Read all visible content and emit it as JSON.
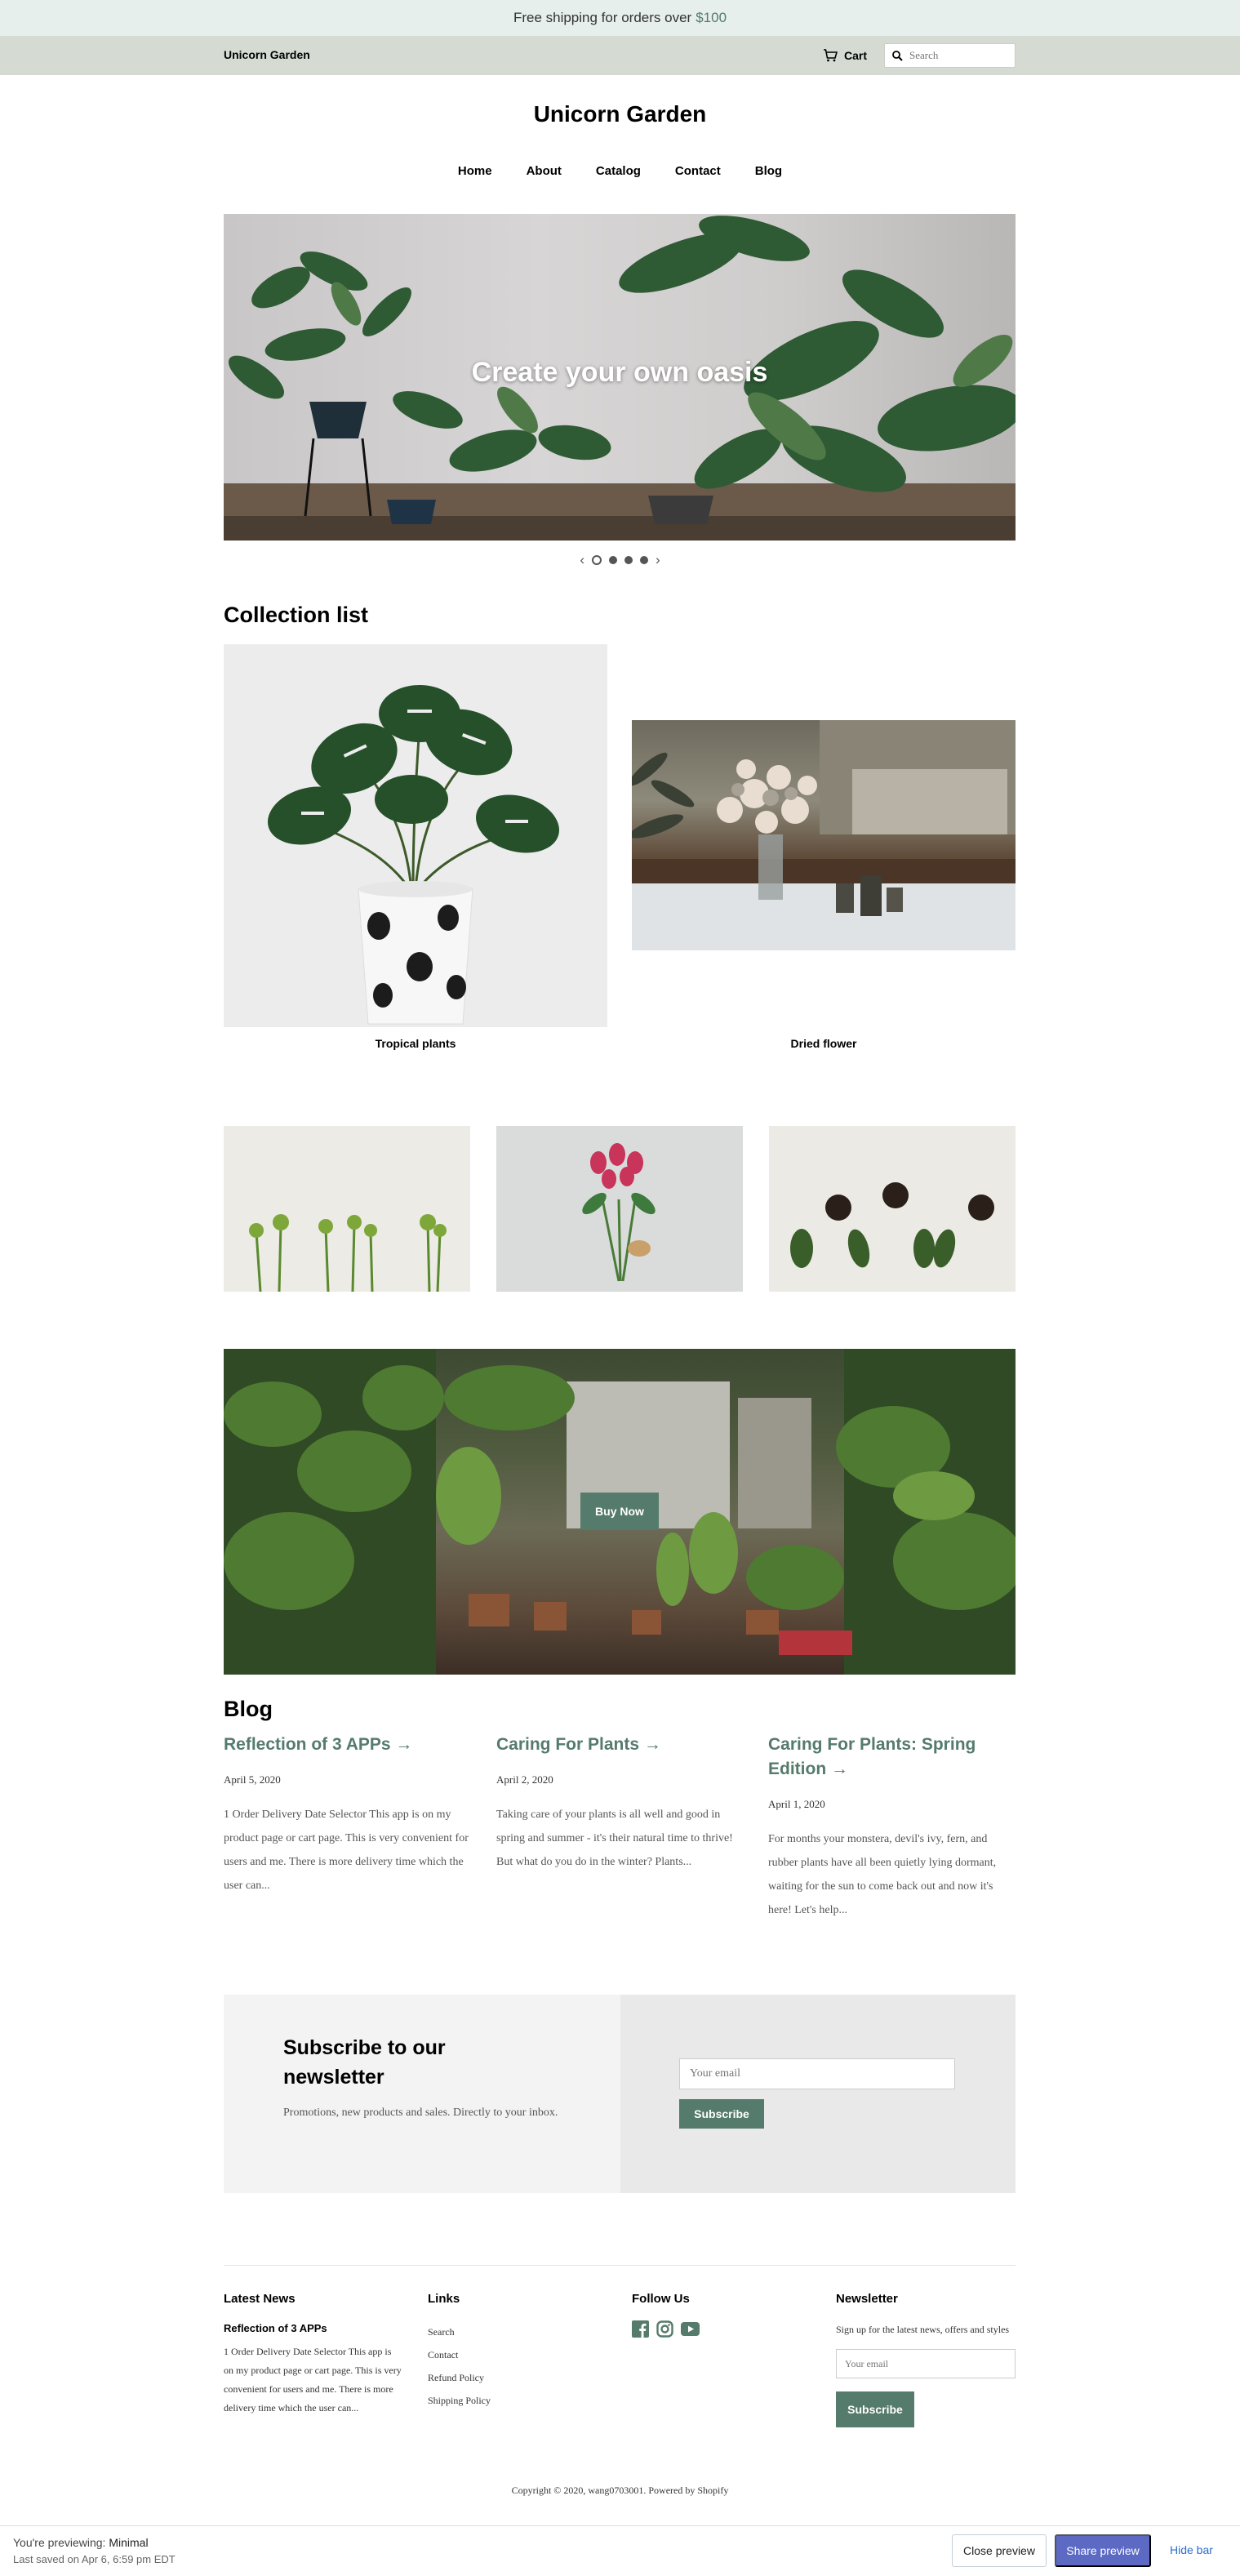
{
  "announcement": {
    "text": "Free shipping for orders over",
    "amount": "$100"
  },
  "header": {
    "brand": "Unicorn Garden",
    "cart_label": "Cart",
    "search_placeholder": "Search"
  },
  "site_title": "Unicorn Garden",
  "nav": [
    "Home",
    "About",
    "Catalog",
    "Contact",
    "Blog"
  ],
  "hero": {
    "title": "Create your own oasis",
    "slides": 4,
    "active_slide": 1
  },
  "collections": {
    "heading": "Collection list",
    "items": [
      {
        "label": "Tropical plants"
      },
      {
        "label": "Dried flower"
      }
    ]
  },
  "banner": {
    "button_label": "Buy Now"
  },
  "blog": {
    "heading": "Blog",
    "posts": [
      {
        "title": "Reflection of 3 APPs →",
        "date": "April 5, 2020",
        "excerpt": "1 Order Delivery Date Selector  This app is on my product page or cart page. This is very convenient for users and me. There is more delivery time which the user can..."
      },
      {
        "title": "Caring For Plants →",
        "date": "April 2, 2020",
        "excerpt": "Taking care of your plants is all well and good in spring and summer - it's their natural time to thrive! But what do you do in the winter? Plants..."
      },
      {
        "title": "Caring For Plants: Spring Edition →",
        "date": "April 1, 2020",
        "excerpt": "For months your monstera, devil's ivy, fern, and rubber plants have all been quietly lying dormant, waiting for the sun to come back out and now it's here! Let's help..."
      }
    ]
  },
  "newsletter_section": {
    "heading": "Subscribe to our newsletter",
    "text": "Promotions, new products and sales. Directly to your inbox.",
    "email_placeholder": "Your email",
    "button_label": "Subscribe"
  },
  "footer": {
    "latest_news": {
      "heading": "Latest News",
      "post_title": "Reflection of 3 APPs",
      "post_excerpt": "1 Order Delivery Date Selector  This app is on my product page or cart page. This is very convenient for users and me. There is more delivery time which the user can..."
    },
    "links": {
      "heading": "Links",
      "items": [
        "Search",
        "Contact",
        "Refund Policy",
        "Shipping Policy"
      ]
    },
    "follow": {
      "heading": "Follow Us",
      "icons": [
        "facebook-icon",
        "instagram-icon",
        "youtube-icon"
      ]
    },
    "newsletter": {
      "heading": "Newsletter",
      "text": "Sign up for the latest news, offers and styles",
      "email_placeholder": "Your email",
      "button_label": "Subscribe"
    },
    "copyright": "Copyright © 2020, wang0703001. Powered by Shopify"
  },
  "preview_bar": {
    "label": "You're previewing:",
    "theme": "Minimal",
    "saved": "Last saved on Apr 6, 6:59 pm EDT",
    "close_label": "Close preview",
    "share_label": "Share preview",
    "hide_label": "Hide bar"
  },
  "colors": {
    "accent": "#557b6c",
    "announce_bg": "#e6efec",
    "topbar_bg": "#d5dbd3",
    "preview_button": "#5c6ac4"
  }
}
